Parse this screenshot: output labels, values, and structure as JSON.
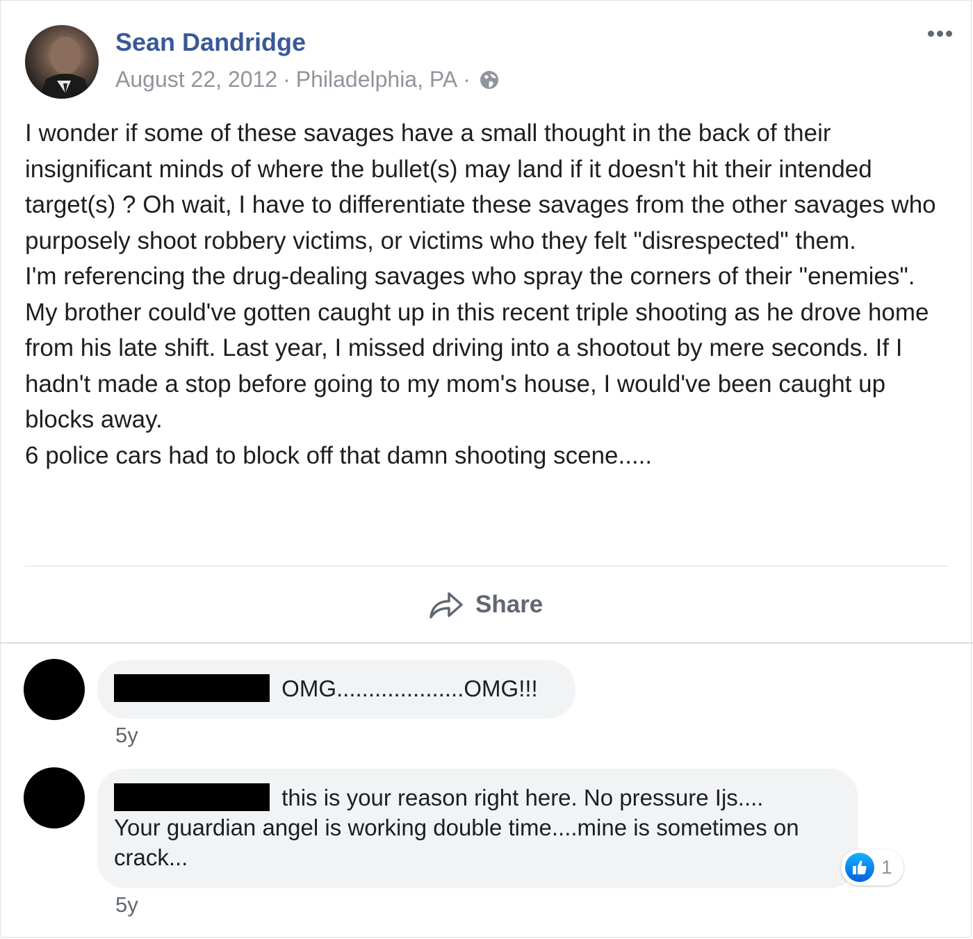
{
  "post": {
    "author": "Sean Dandridge",
    "date": "August 22, 2012",
    "separator": "·",
    "location": "Philadelphia, PA",
    "privacy_icon": "globe-icon",
    "more_icon": "more-options-icon",
    "body": [
      "I wonder if some of these savages have a small thought in the back of their insignificant minds of where the bullet(s) may land if it doesn't hit their intended target(s) ? Oh wait, I have to differentiate these savages from the other savages who purposely shoot robbery victims, or victims who they felt \"disrespected\" them.",
      "I'm referencing the drug-dealing savages who spray the corners of their \"enemies\".",
      "My brother could've gotten caught up in this recent triple shooting as he drove home from his late shift. Last year, I missed driving into a shootout by mere seconds. If I hadn't made a stop before going to my mom's house, I would've been caught up blocks away.",
      "6 police cars had to block off that damn shooting scene....."
    ],
    "share_label": "Share",
    "share_icon": "share-arrow-icon"
  },
  "comments": [
    {
      "author_redacted": true,
      "text": "OMG....................OMG!!!",
      "time": "5y"
    },
    {
      "author_redacted": true,
      "text": "this is your reason right here. No pressure Ijs....",
      "text_cont": "Your guardian angel is working double time....mine is sometimes on crack...",
      "time": "5y",
      "reaction_icon": "like-icon",
      "reaction_count": "1"
    }
  ],
  "colors": {
    "author_link": "#385898",
    "meta_text": "#90949c",
    "bubble_bg": "#f2f3f5",
    "like_blue": "#0062df"
  }
}
